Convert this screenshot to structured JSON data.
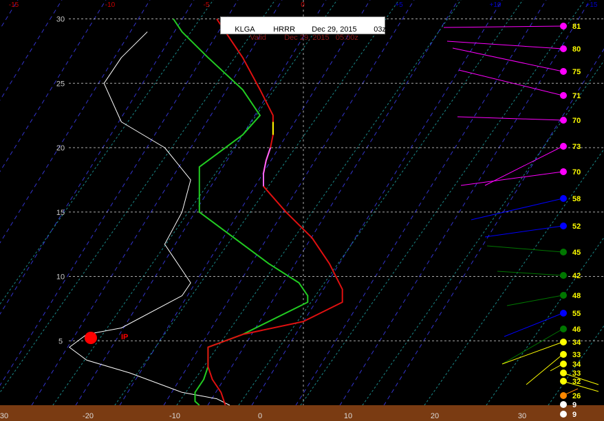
{
  "header": {
    "station": "KLGA",
    "model": "HRRR",
    "run_date": "Dec 29, 2015",
    "run_cycle": "03z",
    "valid_label": "Valid",
    "valid_time": "Dec 29, 2015   05:00z"
  },
  "colors": {
    "background": "#000000",
    "ground": "#7a3b12",
    "temperature": "#e01010",
    "temperature_yellow": "#ffff00",
    "temperature_pink": "#ff66ff",
    "dewpoint": "#22cc22",
    "wetbulb_env": "#ffffff",
    "isotherm": "#3333cc",
    "dry_adiabat": "#1a8a8a",
    "grid": "#aaaaaa",
    "top_axis_neg": "#cc0000",
    "top_axis_pos": "#0000cc"
  },
  "chart_data": {
    "type": "line",
    "y_axis": {
      "ticks": [
        "5",
        "10",
        "15",
        "20",
        "25",
        "30"
      ],
      "range": [
        0,
        30
      ]
    },
    "x_axis_bottom": {
      "ticks": [
        "30",
        "-20",
        "-10",
        "0",
        "10",
        "20",
        "30"
      ],
      "range": [
        -30,
        35
      ]
    },
    "x_axis_top": {
      "ticks": [
        "-15",
        "-10",
        "-5",
        "0",
        "+5",
        "+10",
        "+15"
      ]
    },
    "precip_type": {
      "label": "IP",
      "color": "#ff0000"
    },
    "temperature": [
      [
        -5,
        30
      ],
      [
        -4,
        29
      ],
      [
        -2,
        27
      ],
      [
        0,
        24.5
      ],
      [
        1.5,
        22.5
      ],
      [
        1.5,
        22
      ],
      [
        1.5,
        21
      ],
      [
        1.2,
        20
      ],
      [
        0.7,
        19
      ],
      [
        0.4,
        18
      ],
      [
        0.4,
        17
      ],
      [
        3,
        15
      ],
      [
        6,
        13
      ],
      [
        8,
        11
      ],
      [
        9.5,
        9
      ],
      [
        9.5,
        8
      ],
      [
        5,
        6.5
      ],
      [
        -2,
        5.5
      ],
      [
        -6,
        4.5
      ],
      [
        -6,
        3
      ],
      [
        -5.5,
        2
      ],
      [
        -4.5,
        1
      ],
      [
        -4,
        0
      ]
    ],
    "temperature_yellow_segment": [
      [
        1.5,
        22
      ],
      [
        1.5,
        21
      ]
    ],
    "temperature_pink_segment": [
      [
        1.2,
        20
      ],
      [
        0.7,
        19
      ],
      [
        0.4,
        18
      ],
      [
        0.4,
        17
      ]
    ],
    "dewpoint": [
      [
        -10,
        30
      ],
      [
        -9,
        29
      ],
      [
        -6,
        27
      ],
      [
        -2,
        24.5
      ],
      [
        0,
        22.5
      ],
      [
        -2,
        21
      ],
      [
        -5,
        19.5
      ],
      [
        -7,
        18.5
      ],
      [
        -7,
        17
      ],
      [
        -7,
        15
      ],
      [
        -3,
        13
      ],
      [
        1,
        11
      ],
      [
        4.5,
        9.5
      ],
      [
        5.5,
        8.5
      ],
      [
        5.5,
        8
      ],
      [
        -2,
        5.5
      ],
      [
        -6,
        4.5
      ],
      [
        -6,
        3
      ],
      [
        -6.5,
        2
      ],
      [
        -7.5,
        1
      ],
      [
        -7.5,
        0.3
      ],
      [
        -7,
        0
      ]
    ],
    "white_profile": [
      [
        -13,
        29
      ],
      [
        -16,
        27
      ],
      [
        -18,
        25
      ],
      [
        -16,
        22
      ],
      [
        -11,
        20
      ],
      [
        -8,
        17.5
      ],
      [
        -9,
        15
      ],
      [
        -11,
        12.5
      ],
      [
        -9,
        10.5
      ],
      [
        -8,
        9.5
      ],
      [
        -9,
        8.5
      ],
      [
        -16,
        6
      ],
      [
        -20,
        5.5
      ],
      [
        -22,
        4.5
      ],
      [
        -20,
        3.5
      ],
      [
        -15,
        2.5
      ],
      [
        -11,
        1.5
      ],
      [
        -9,
        1
      ],
      [
        -5,
        0.5
      ],
      [
        -3.5,
        0
      ]
    ],
    "wind_levels": [
      {
        "label": "81",
        "color": "#ff00ff"
      },
      {
        "label": "80",
        "color": "#ff00ff"
      },
      {
        "label": "75",
        "color": "#ff00ff"
      },
      {
        "label": "71",
        "color": "#ff00ff"
      },
      {
        "label": "70",
        "color": "#ff00ff"
      },
      {
        "label": "73",
        "color": "#ff00ff"
      },
      {
        "label": "70",
        "color": "#ff00ff"
      },
      {
        "label": "58",
        "color": "#0000ff"
      },
      {
        "label": "52",
        "color": "#0000ff"
      },
      {
        "label": "45",
        "color": "#007700"
      },
      {
        "label": "42",
        "color": "#007700"
      },
      {
        "label": "48",
        "color": "#007700"
      },
      {
        "label": "55",
        "color": "#0000ff"
      },
      {
        "label": "46",
        "color": "#007700"
      },
      {
        "label": "34",
        "color": "#ffff00"
      },
      {
        "label": "33",
        "color": "#ffff00"
      },
      {
        "label": "34",
        "color": "#ffff00"
      },
      {
        "label": "33",
        "color": "#ffff00"
      },
      {
        "label": "32",
        "color": "#ffff00"
      },
      {
        "label": "26",
        "color": "#ff8800"
      },
      {
        "label": "9",
        "color": "#ffffff"
      },
      {
        "label": "9",
        "color": "#ffffff"
      }
    ]
  }
}
